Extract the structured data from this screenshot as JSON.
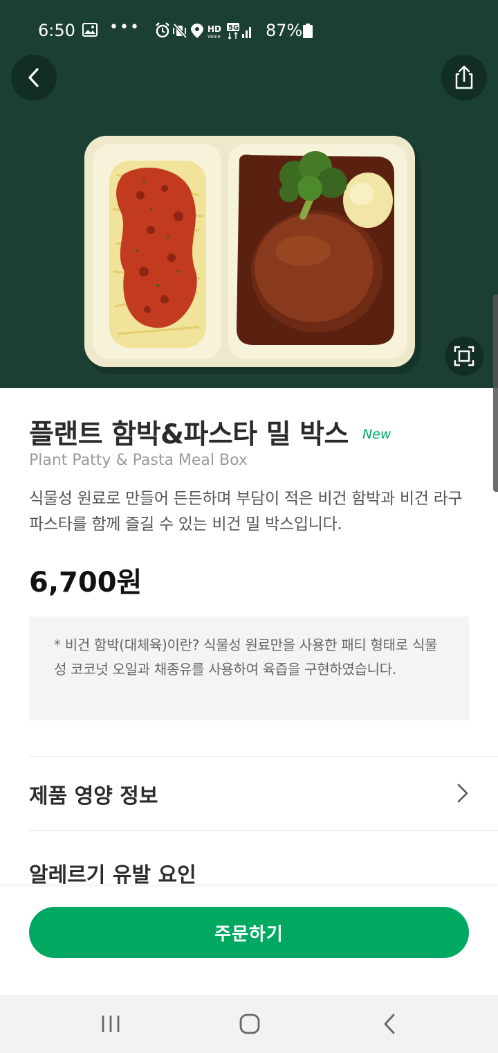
{
  "status_bar": {
    "time": "6:50",
    "more_indicator": "•••",
    "battery_percent": "87%",
    "icons": [
      "gallery-icon",
      "alarm-icon",
      "vibrate-icon",
      "location-icon",
      "hd-voice-icon",
      "5g-icon",
      "signal-icon",
      "battery-icon"
    ]
  },
  "header": {
    "back_icon": "chevron-left-icon",
    "share_icon": "share-icon",
    "expand_icon": "expand-frame-icon"
  },
  "product": {
    "title": "플랜트 함박&파스타 밀 박스",
    "badge": "New",
    "subtitle": "Plant Patty & Pasta Meal Box",
    "description": "식물성 원료로 만들어 든든하며 부담이 적은 비건 함박과 비건 라구 파스타를 함께 즐길 수 있는 비건 밀 박스입니다.",
    "price": "6,700원",
    "note": "* 비건 함박(대체육)이란? 식물성 원료만을 사용한 패티 형태로 식물성 코코넛 오일과 채종유를 사용하여 육즙을 구현하였습니다."
  },
  "sections": {
    "nutrition_label": "제품 영양 정보",
    "allergy_label": "알레르기 유발 요인"
  },
  "order": {
    "button_label": "주문하기"
  },
  "colors": {
    "hero_bg": "#1c3f33",
    "accent": "#00a862"
  }
}
